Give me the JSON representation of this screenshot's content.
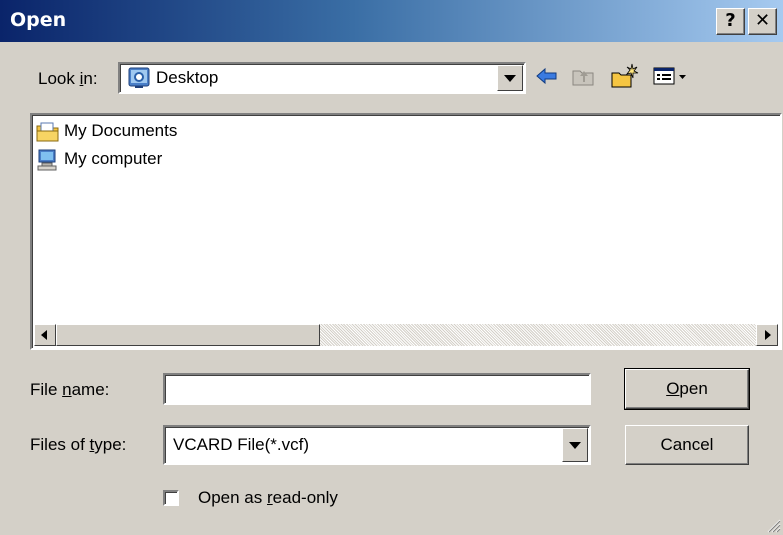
{
  "window": {
    "title": "Open",
    "help_glyph": "?",
    "close_glyph": "✕"
  },
  "look_in": {
    "label_pre": "Look ",
    "label_key": "i",
    "label_post": "n:",
    "value": "Desktop"
  },
  "toolbar": {
    "icons": [
      "back-arrow-icon",
      "up-one-level-icon",
      "create-new-folder-icon",
      "view-menu-icon"
    ],
    "colors": {
      "back_arrow": "#3a7ae0",
      "folder": "#f5c542"
    }
  },
  "files": [
    {
      "name": "My Documents",
      "icon": "my-documents-icon"
    },
    {
      "name": "My computer",
      "icon": "my-computer-icon"
    }
  ],
  "file_name": {
    "label_pre": "File ",
    "label_key": "n",
    "label_post": "ame:",
    "value": ""
  },
  "file_type": {
    "label_pre": "Files of ",
    "label_key": "t",
    "label_post": "ype:",
    "value": "VCARD File(*.vcf)"
  },
  "readonly": {
    "label_pre": "Open as ",
    "label_key": "r",
    "label_post": "ead-only",
    "checked": false
  },
  "buttons": {
    "open_key": "O",
    "open_rest": "pen",
    "cancel": "Cancel"
  }
}
